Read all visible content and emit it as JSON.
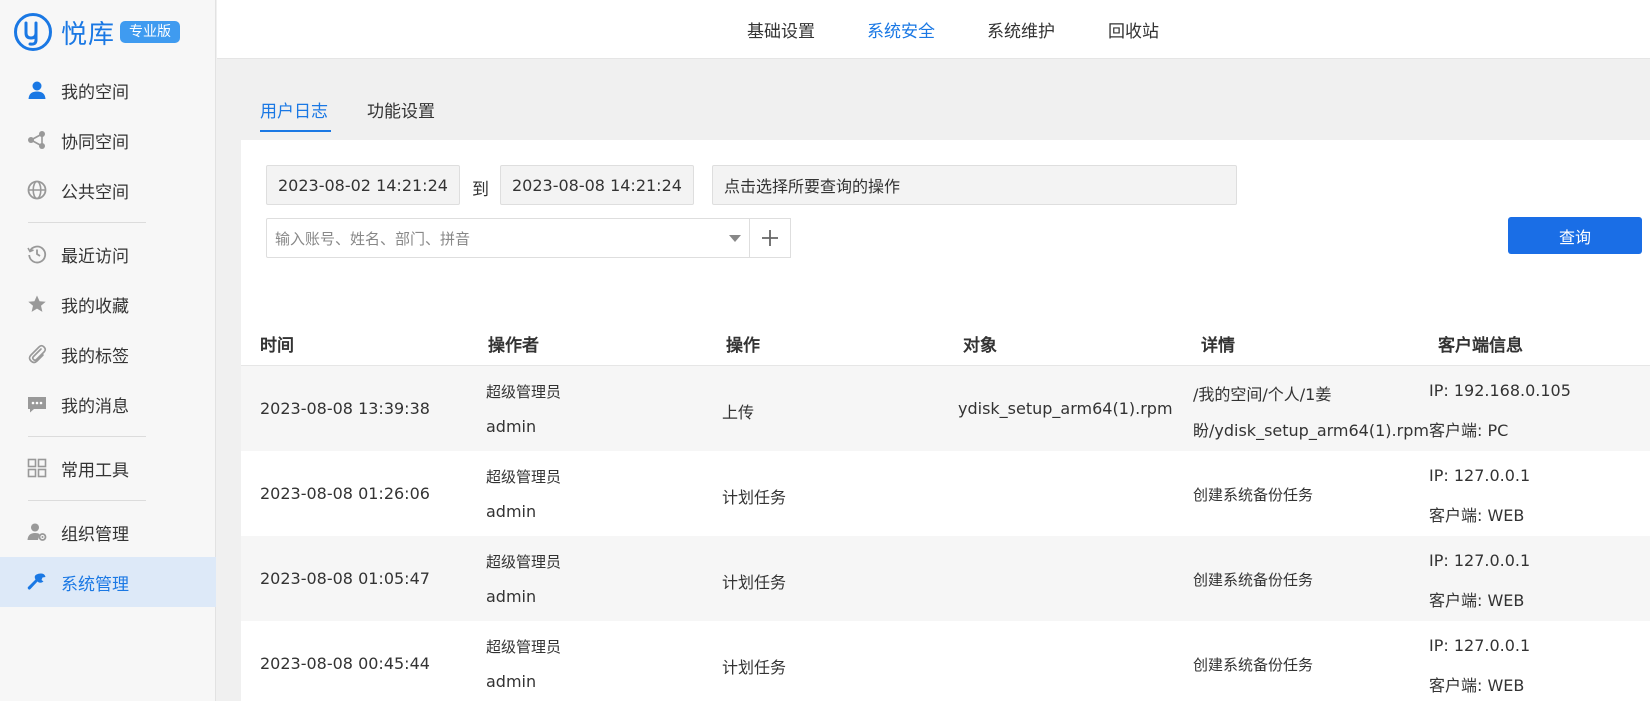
{
  "app": {
    "logo_text": "悦库",
    "edition_badge": "专业版",
    "accent_color": "#1a78e4"
  },
  "sidebar": {
    "items": [
      {
        "label": "我的空间",
        "icon": "user-icon"
      },
      {
        "label": "协同空间",
        "icon": "share-network-icon"
      },
      {
        "label": "公共空间",
        "icon": "globe-icon"
      },
      {
        "label": "最近访问",
        "icon": "history-clock-icon"
      },
      {
        "label": "我的收藏",
        "icon": "star-icon"
      },
      {
        "label": "我的标签",
        "icon": "paperclip-icon"
      },
      {
        "label": "我的消息",
        "icon": "message-icon"
      },
      {
        "label": "常用工具",
        "icon": "grid-icon"
      },
      {
        "label": "组织管理",
        "icon": "user-gear-icon"
      },
      {
        "label": "系统管理",
        "icon": "wrench-icon",
        "active": true
      }
    ]
  },
  "topnav": {
    "tabs": [
      {
        "label": "基础设置"
      },
      {
        "label": "系统安全",
        "active": true
      },
      {
        "label": "系统维护"
      },
      {
        "label": "回收站"
      }
    ]
  },
  "subtabs": [
    {
      "label": "用户日志",
      "active": true
    },
    {
      "label": "功能设置"
    }
  ],
  "filters": {
    "start_time": "2023-08-02 14:21:24",
    "to_label": "到",
    "end_time": "2023-08-08 14:21:24",
    "operation_placeholder": "点击选择所要查询的操作",
    "user_placeholder": "输入账号、姓名、部门、拼音",
    "query_label": "查询"
  },
  "table": {
    "columns": [
      "时间",
      "操作者",
      "操作",
      "对象",
      "详情",
      "客户端信息"
    ],
    "rows": [
      {
        "time": "2023-08-08 13:39:38",
        "operator_name": "超级管理员",
        "operator_account": "admin",
        "operation": "上传",
        "object": "ydisk_setup_arm64(1).rpm",
        "detail_line1": "/我的空间/个人/1姜",
        "detail_line2": "盼/ydisk_setup_arm64(1).rpm",
        "client_ip": "IP: 192.168.0.105",
        "client_type": "客户端: PC"
      },
      {
        "time": "2023-08-08 01:26:06",
        "operator_name": "超级管理员",
        "operator_account": "admin",
        "operation": "计划任务",
        "object": "",
        "detail_line1": "创建系统备份任务",
        "detail_line2": "",
        "client_ip": "IP: 127.0.0.1",
        "client_type": "客户端: WEB"
      },
      {
        "time": "2023-08-08 01:05:47",
        "operator_name": "超级管理员",
        "operator_account": "admin",
        "operation": "计划任务",
        "object": "",
        "detail_line1": "创建系统备份任务",
        "detail_line2": "",
        "client_ip": "IP: 127.0.0.1",
        "client_type": "客户端: WEB"
      },
      {
        "time": "2023-08-08 00:45:44",
        "operator_name": "超级管理员",
        "operator_account": "admin",
        "operation": "计划任务",
        "object": "",
        "detail_line1": "创建系统备份任务",
        "detail_line2": "",
        "client_ip": "IP: 127.0.0.1",
        "client_type": "客户端: WEB"
      }
    ]
  }
}
